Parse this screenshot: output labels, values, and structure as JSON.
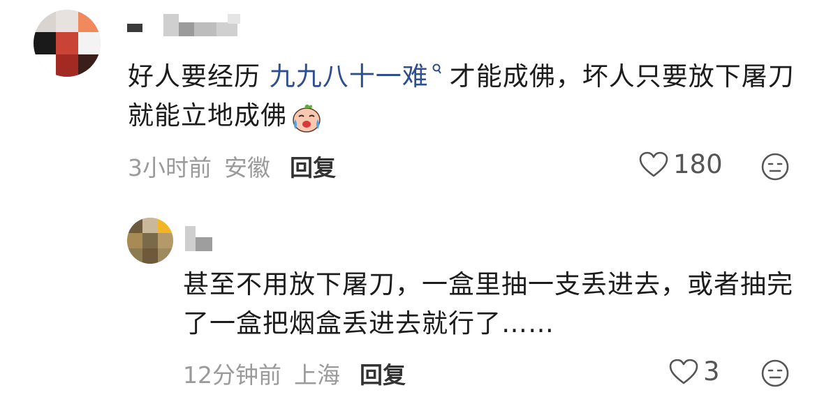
{
  "comment": {
    "username": "",
    "text_before_link": "好人要经历 ",
    "link_text": "九九八十一难",
    "text_after_link": "才能成佛，坏人只要放下屠刀就能立地成佛",
    "emoji": "crying-face-emoji",
    "time": "3小时前",
    "location": "安徽",
    "reply_label": "回复",
    "likes": "180"
  },
  "reply": {
    "username": "",
    "text": "甚至不用放下屠刀，一盒里抽一支丢进去，或者抽完了一盒把烟盒丢进去就行了……",
    "time": "12分钟前",
    "location": "上海",
    "reply_label": "回复",
    "likes": "3"
  },
  "colors": {
    "link": "#2e4f8f",
    "meta": "#9a9a9a",
    "text": "#1c1c1c"
  }
}
